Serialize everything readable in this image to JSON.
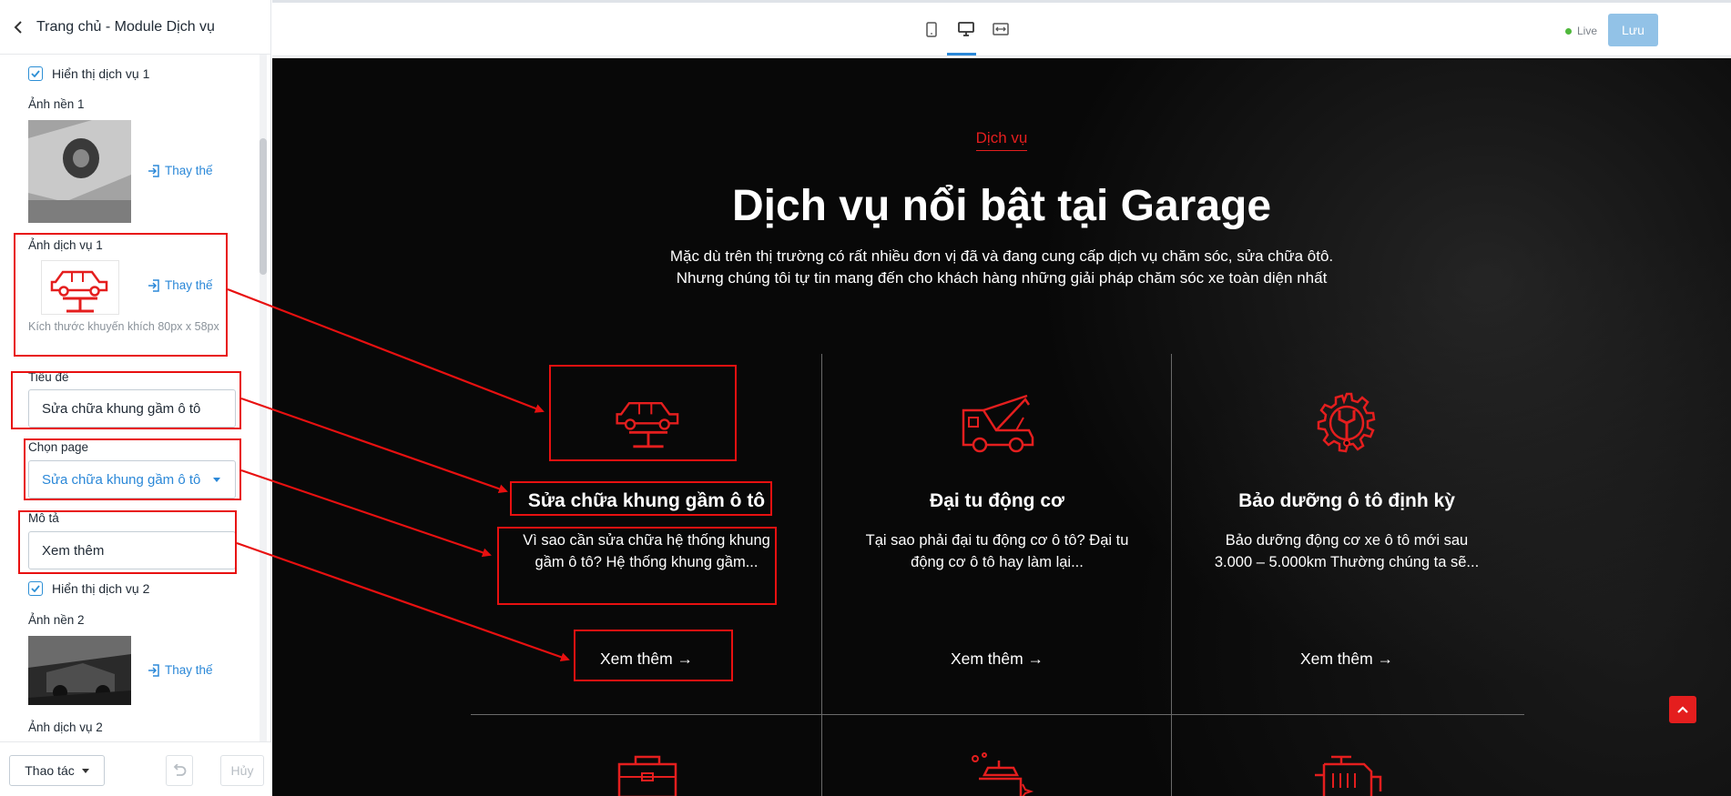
{
  "sidebar": {
    "title": "Trang chủ - Module Dịch vụ",
    "show_service_1": "Hiển thị dịch vụ 1",
    "bg_image_1_label": "Ảnh nền 1",
    "replace_label": "Thay thế",
    "service_image_1_label": "Ảnh dịch vụ 1",
    "size_hint": "Kích thước khuyến khích 80px x 58px",
    "title_label": "Tiêu đề",
    "title_value": "Sửa chữa khung gầm ô tô",
    "page_label": "Chọn page",
    "page_value": "Sửa chữa khung gầm ô tô",
    "desc_label": "Mô tả",
    "desc_value": "Xem thêm",
    "show_service_2": "Hiển thị dịch vụ 2",
    "bg_image_2_label": "Ảnh nền 2",
    "service_image_2_label": "Ảnh dịch vụ 2"
  },
  "footer": {
    "action_label": "Thao tác",
    "cancel_label": "Hủy"
  },
  "topbar": {
    "live_label": "Live",
    "save_label": "Lưu"
  },
  "preview": {
    "section_label": "Dịch vụ",
    "section_title": "Dịch vụ nổi bật tại Garage",
    "desc_line_1": "Mặc dù trên thị trường có rất nhiều đơn vị đã và đang cung cấp dịch vụ chăm sóc, sửa chữa ôtô.",
    "desc_line_2": "Nhưng chúng tôi tự tin mang đến cho khách hàng những giải pháp chăm sóc xe toàn diện nhất",
    "cards": [
      {
        "title": "Sửa chữa khung gầm ô tô",
        "desc": "Vì sao cần sửa chữa hệ thống khung gầm ô tô? Hệ thống khung gầm...",
        "more": "Xem thêm →"
      },
      {
        "title": "Đại tu động cơ",
        "desc": "Tại sao phải đại tu động cơ ô tô? Đại tu động cơ ô tô hay làm lại...",
        "more": "Xem thêm →"
      },
      {
        "title": "Bảo dưỡng ô tô định kỳ",
        "desc": "Bảo dưỡng động cơ xe ô tô mới sau 3.000 – 5.000km Thường chúng ta sẽ...",
        "more": "Xem thêm →"
      }
    ]
  },
  "colors": {
    "accent_red": "#e41e1e",
    "link_blue": "#2b88d8",
    "save_blue": "#92c2e7",
    "annotation_red": "#e81010"
  },
  "icons": [
    "back-arrow-icon",
    "checkbox-checked-icon",
    "replace-icon",
    "caret-down-icon",
    "undo-icon",
    "mobile-icon",
    "desktop-icon",
    "fullwidth-icon",
    "car-lift-icon",
    "car-hood-icon",
    "gear-wrench-icon",
    "toolbox-icon",
    "car-wash-icon",
    "engine-icon",
    "chevron-up-icon"
  ]
}
